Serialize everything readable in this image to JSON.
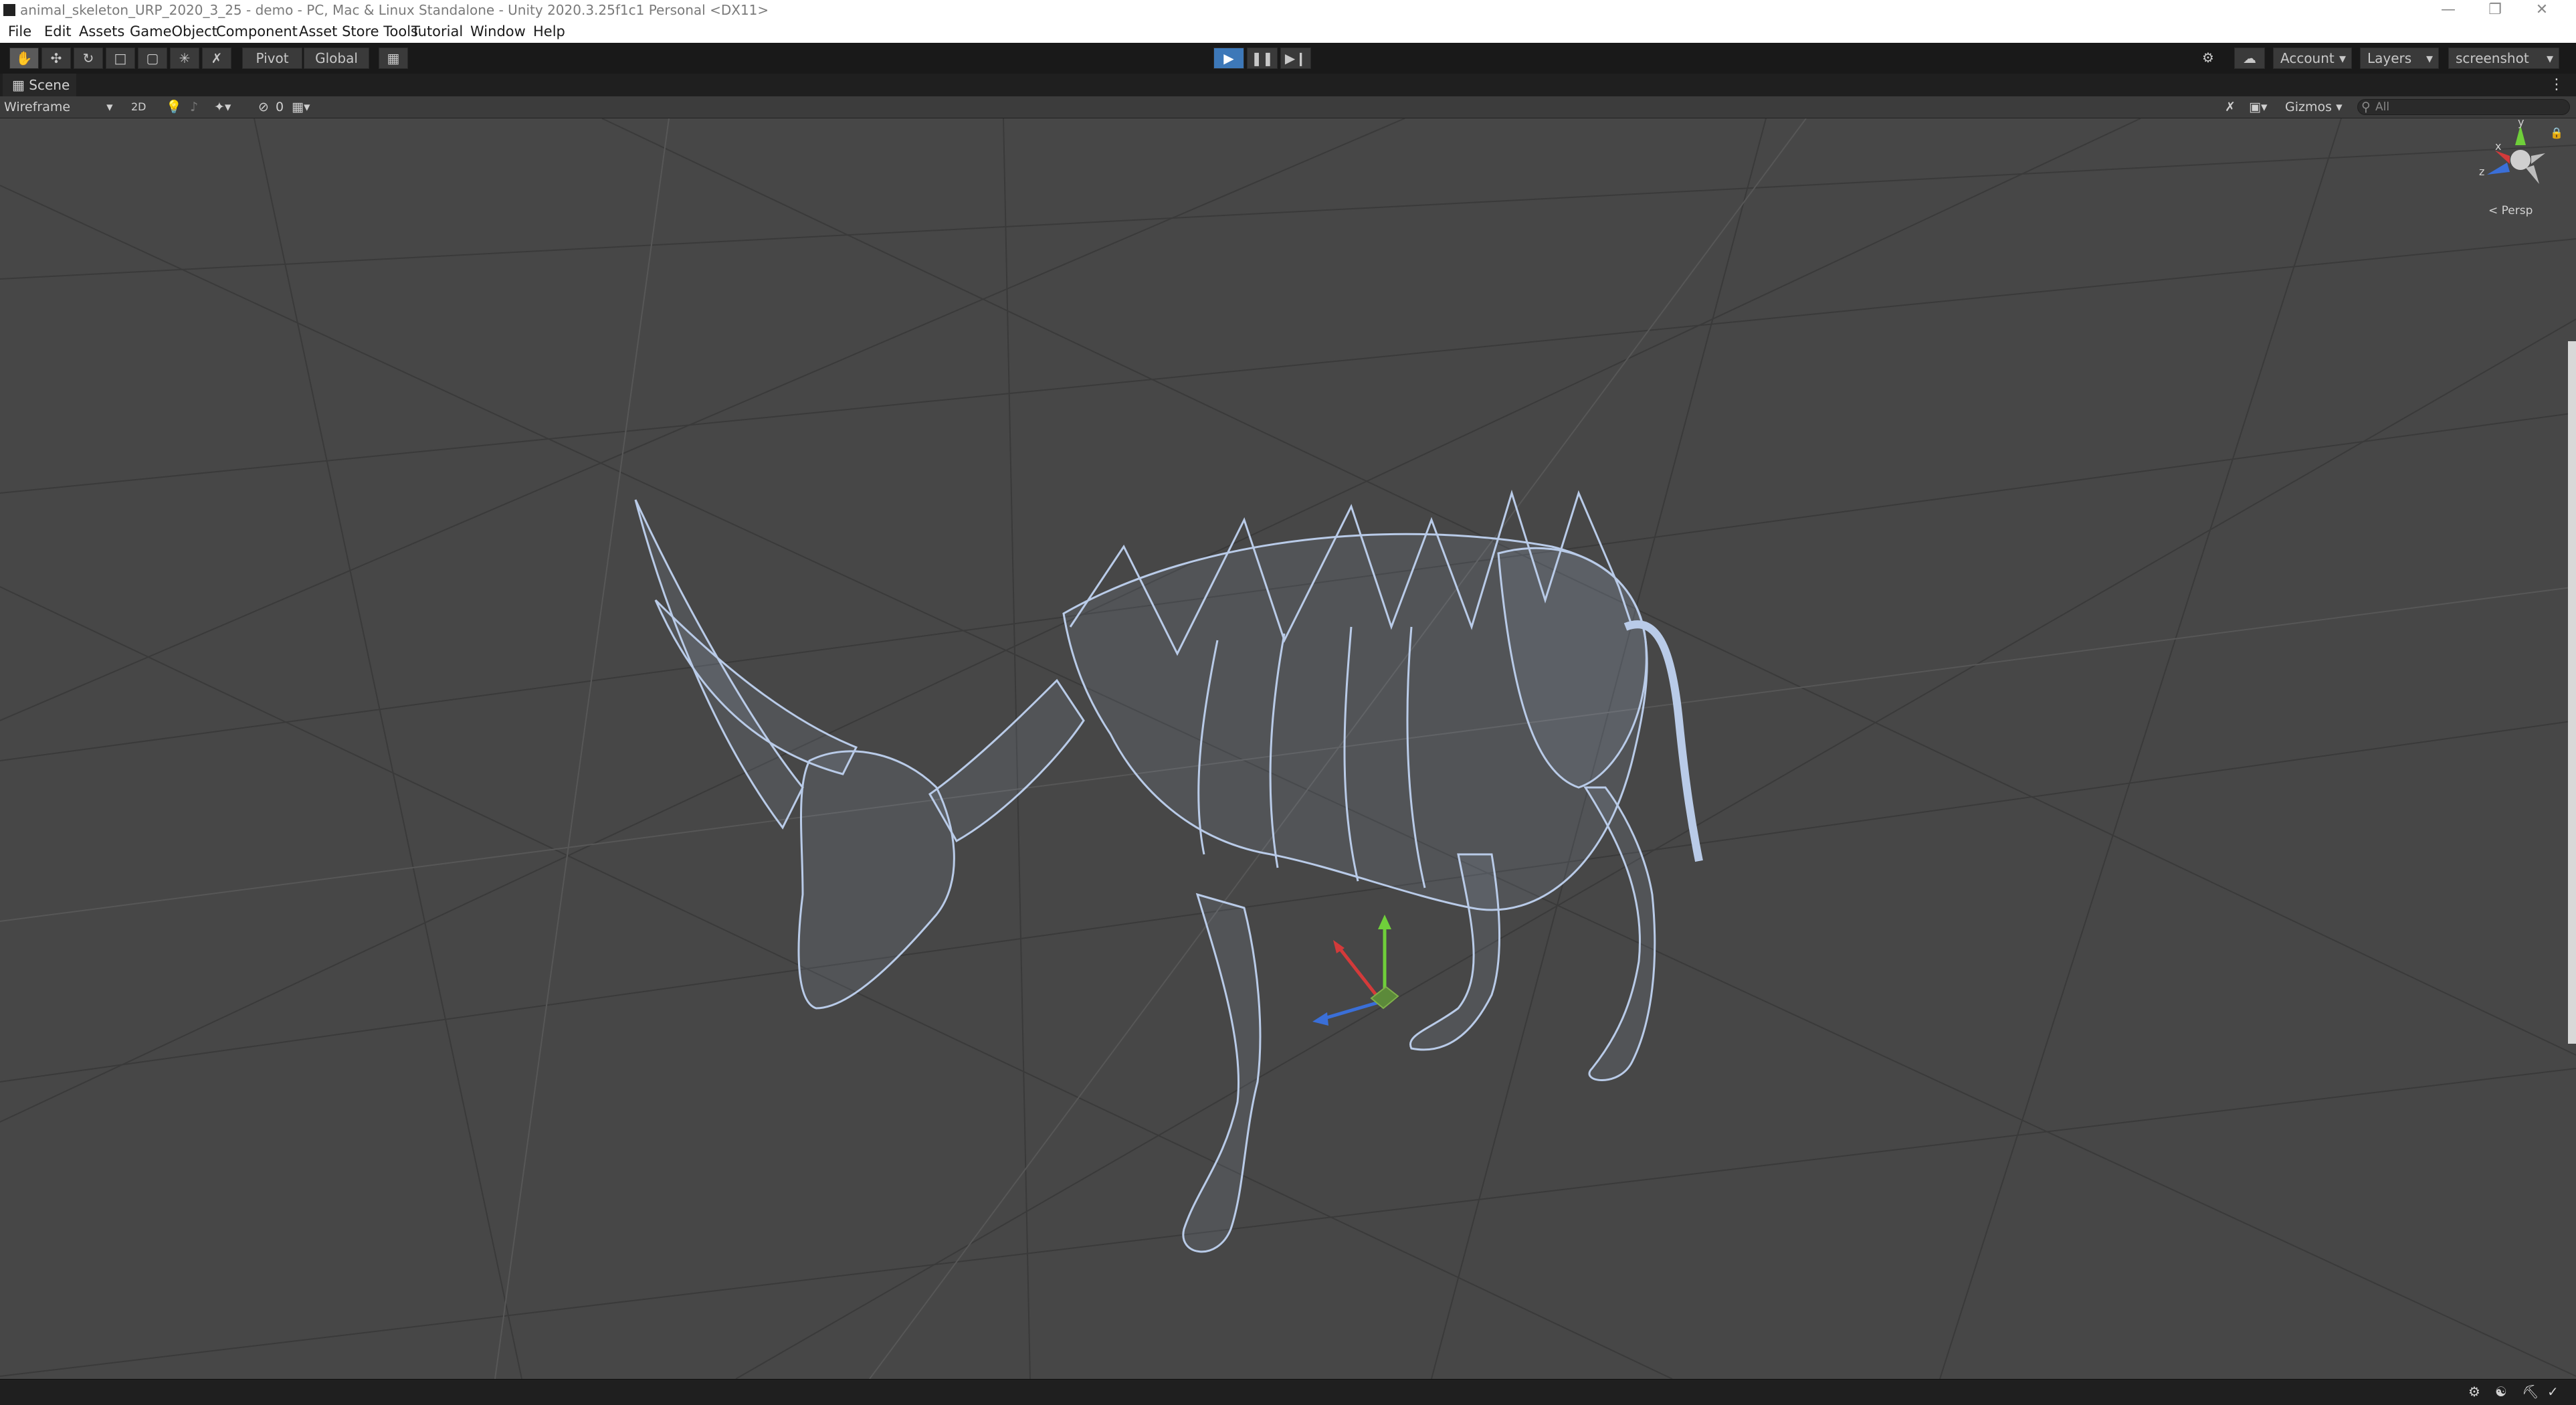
{
  "window": {
    "title": "animal_skeleton_URP_2020_3_25 - demo - PC, Mac & Linux Standalone - Unity 2020.3.25f1c1 Personal <DX11>",
    "minimize_icon": "minimize-icon",
    "restore_icon": "restore-icon",
    "close_icon": "close-icon"
  },
  "menu": {
    "items": [
      "File",
      "Edit",
      "Assets",
      "GameObject",
      "Component",
      "Asset Store Tools",
      "Tutorial",
      "Window",
      "Help"
    ]
  },
  "toolbar": {
    "pivot_label": "Pivot",
    "global_label": "Global",
    "account_label": "Account",
    "layers_label": "Layers",
    "layout_label": "screenshot"
  },
  "scene_tab": {
    "label": "Scene"
  },
  "scene_bar": {
    "draw_mode": "Wireframe",
    "two_d_label": "2D",
    "hidden_count": "0",
    "gizmos_label": "Gizmos",
    "search_placeholder": "All"
  },
  "orientation_gizmo": {
    "x_label": "x",
    "y_label": "y",
    "z_label": "z",
    "projection_label": "< Persp",
    "x_color": "#d33a3a",
    "y_color": "#6fcf3a",
    "z_color": "#3a6fd8"
  },
  "colors": {
    "wireframe": "#b9cbe8",
    "play_button": "#3d78b8",
    "viewport_bg": "#474747"
  }
}
